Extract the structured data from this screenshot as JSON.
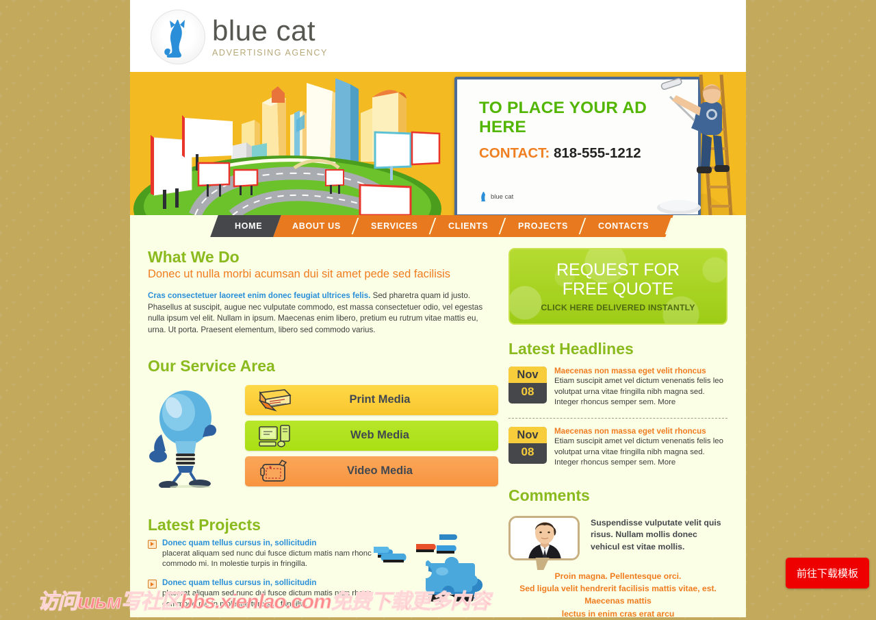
{
  "site": {
    "logo_main": "blue cat",
    "logo_sub": "ADVERTISING  AGENCY",
    "logo_icon": "blue-cat-silhouette-icon"
  },
  "banner": {
    "headline": "TO PLACE YOUR AD HERE",
    "contact_label": "CONTACT:",
    "contact_number": "818-555-1212",
    "billboard_logo_text": "blue cat"
  },
  "nav": {
    "items": [
      {
        "label": "HOME",
        "active": true
      },
      {
        "label": "ABOUT US",
        "active": false
      },
      {
        "label": "SERVICES",
        "active": false
      },
      {
        "label": "CLIENTS",
        "active": false
      },
      {
        "label": "PROJECTS",
        "active": false
      },
      {
        "label": "CONTACTS",
        "active": false
      }
    ]
  },
  "what_we_do": {
    "title": "What We Do",
    "subtitle": "Donec ut nulla morbi acumsan dui sit amet pede sed facilisis",
    "lead": "Cras consectetuer laoreet enim donec feugiat ultrices felis.",
    "body": " Sed pharetra quam id justo. Phasellus at suscipit, augue nec vulputate commodo, est massa consectetuer odio, vel egestas nulla ipsum vel elit. Nullam in ipsum. Maecenas enim libero, pretium eu rutrum vitae mattis eu, urna. Ut porta. Praesent elementum, libero sed commodo varius."
  },
  "service_area": {
    "title": "Our Service Area",
    "mascot": "light-bulb-mascot-icon",
    "buttons": [
      {
        "label": "Print Media",
        "icon": "newspaper-icon",
        "color": "#f9c62e"
      },
      {
        "label": "Web Media",
        "icon": "computer-icon",
        "color": "#a9df13"
      },
      {
        "label": "Video  Media",
        "icon": "video-camera-icon",
        "color": "#f79440"
      }
    ]
  },
  "latest_projects": {
    "title": "Latest Projects",
    "items": [
      {
        "title": "Donec quam tellus cursus in, sollicitudin",
        "body": "placerat aliquam sed nunc dui fusce dictum matis nam rhonc commodo mi. In molestie turpis in fringilla."
      },
      {
        "title": "Donec quam tellus cursus in, sollicitudin",
        "body": "placerat aliquam sed nunc dui fusce dictum matis nam rhonc commodo mi. In molestie turpis in fringilla."
      }
    ],
    "art": "jigsaw-puzzle-pieces-icon"
  },
  "quote_box": {
    "line1": "REQUEST FOR",
    "line2": "FREE QUOTE",
    "line3": "CLICK HERE DELIVERED INSTANTLY"
  },
  "headlines": {
    "title": "Latest Headlines",
    "items": [
      {
        "month": "Nov",
        "day": "08",
        "title": "Maecenas non massa eget velit rhoncus",
        "body": "Etiam suscipit amet vel dictum venenatis felis leo volutpat urna vitae fringilla nibh magna sed. Integer rhoncus semper sem. More"
      },
      {
        "month": "Nov",
        "day": "08",
        "title": "Maecenas non massa eget velit rhoncus",
        "body": "Etiam suscipit amet vel dictum venenatis felis leo volutpat urna vitae fringilla nibh magna sed. Integer rhoncus semper sem. More"
      }
    ]
  },
  "comments": {
    "title": "Comments",
    "avatar": "man-in-suit-avatar",
    "quote": "Suspendisse vulputate velit quis risus. Nullam mollis donec vehicul est vitae mollis.",
    "signature_lines": [
      "Proin magna. Pellentesque orci.",
      "Sed ligula velit hendrerit facilisis mattis vitae, est.",
      "Maecenas mattis",
      "lectus in enim cras erat arcu"
    ]
  },
  "overlay": {
    "watermark": "访问шьм写社区bbs.xienlao.com免费下载更多内容",
    "download_button": "前往下载模板"
  },
  "colors": {
    "page_bg": "#c2a95c",
    "content_bg": "#fbffe6",
    "nav_orange": "#e8791e",
    "nav_active": "#45474a",
    "green_heading": "#8aba1e",
    "orange_text": "#f07c20",
    "link_blue": "#2a8fd8",
    "banner_yellow": "#f3ba22"
  }
}
